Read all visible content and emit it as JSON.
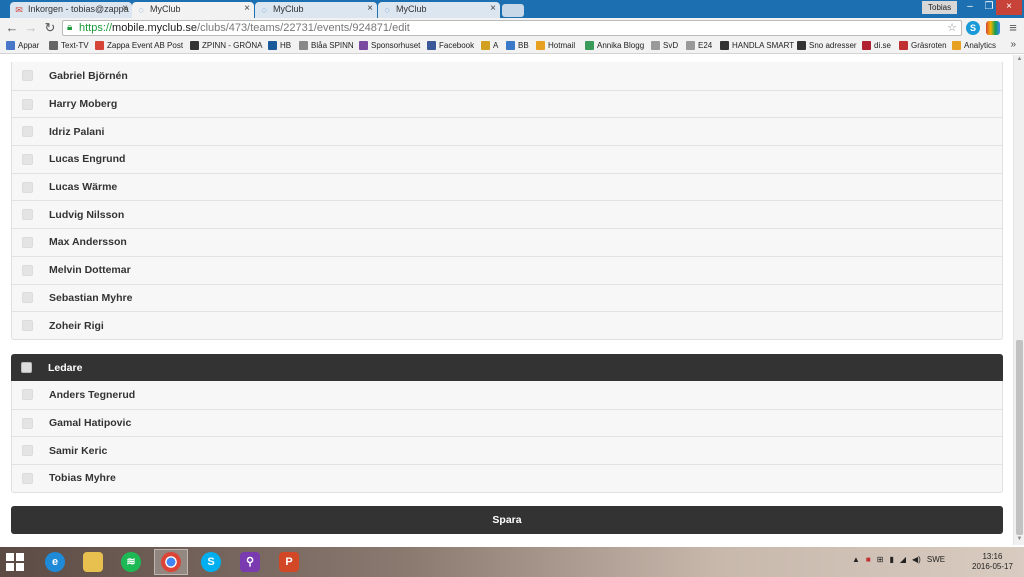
{
  "browser": {
    "tabs": [
      {
        "title": "Inkorgen - tobias@zappa",
        "active": false
      },
      {
        "title": "MyClub",
        "active": true
      },
      {
        "title": "MyClub",
        "active": false
      },
      {
        "title": "MyClub",
        "active": false
      }
    ],
    "profile_name": "Tobias",
    "url_scheme": "https://",
    "url_host": "mobile.myclub.se",
    "url_path": "/clubs/473/teams/22731/events/924871/edit",
    "bookmarks": [
      {
        "label": "Appar",
        "color": "#4a78c8"
      },
      {
        "label": "Text-TV",
        "color": "#666666"
      },
      {
        "label": "Zappa Event AB Post",
        "color": "#d64437"
      },
      {
        "label": "ZPINN - GRÖNA",
        "color": "#333333"
      },
      {
        "label": "HB",
        "color": "#1a5a9a"
      },
      {
        "label": "Blåa SPINN",
        "color": "#888888"
      },
      {
        "label": "Sponsorhuset",
        "color": "#7a4aa0"
      },
      {
        "label": "Facebook",
        "color": "#3b5998"
      },
      {
        "label": "A",
        "color": "#d1a020"
      },
      {
        "label": "BB",
        "color": "#3a78c8"
      },
      {
        "label": "Hotmail",
        "color": "#e8a020"
      },
      {
        "label": "Annika Blogg",
        "color": "#3a9a5a"
      },
      {
        "label": "SvD",
        "color": "#999999"
      },
      {
        "label": "E24",
        "color": "#999999"
      },
      {
        "label": "HANDLA SMART",
        "color": "#333333"
      },
      {
        "label": "Sno adresser",
        "color": "#333333"
      },
      {
        "label": "di.se",
        "color": "#b02030"
      },
      {
        "label": "Gräsroten",
        "color": "#c03030"
      },
      {
        "label": "Analytics",
        "color": "#e8a020"
      }
    ]
  },
  "players": [
    "Gabriel Björnén",
    "Harry Moberg",
    "Idriz Palani",
    "Lucas Engrund",
    "Lucas Wärme",
    "Ludvig Nilsson",
    "Max Andersson",
    "Melvin Dottemar",
    "Sebastian Myhre",
    "Zoheir Rigi"
  ],
  "leaders_group": {
    "title": "Ledare",
    "members": [
      "Anders Tegnerud",
      "Gamal Hatipovic",
      "Samir Keric",
      "Tobias Myhre"
    ]
  },
  "save_label": "Spara",
  "taskbar": {
    "language": "SWE",
    "time": "13:16",
    "date": "2016-05-17"
  },
  "colors": {
    "accent_dark": "#333333",
    "row_bg": "#f7f7f7",
    "secure_green": "#1a9a3a"
  }
}
